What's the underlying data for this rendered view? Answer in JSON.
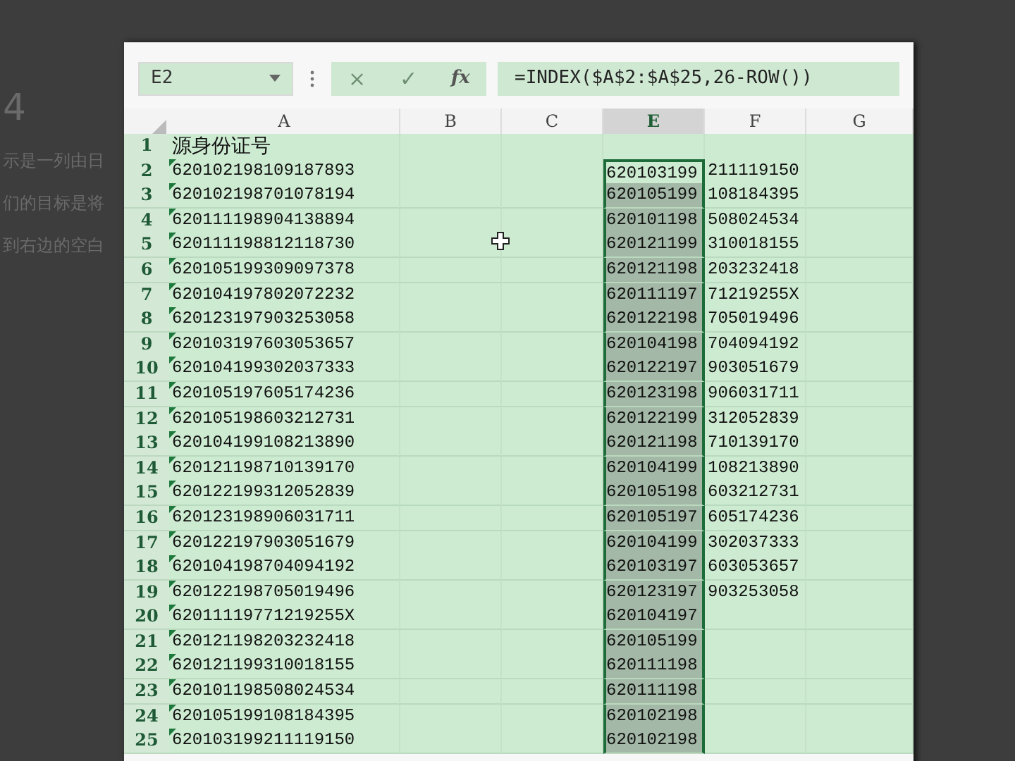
{
  "background": {
    "heading": "4",
    "lines": [
      "示是一列由日",
      "们的目标是将",
      "到右边的空白"
    ]
  },
  "name_box": {
    "value": "E2"
  },
  "formula_bar": {
    "cancel": "×",
    "enter": "✓",
    "fx": "fx",
    "value": "=INDEX($A$2:$A$25,26-ROW())"
  },
  "columns": [
    {
      "label": "A",
      "selected": false
    },
    {
      "label": "B",
      "selected": false
    },
    {
      "label": "C",
      "selected": false
    },
    {
      "label": "E",
      "selected": true
    },
    {
      "label": "F",
      "selected": false
    },
    {
      "label": "G",
      "selected": false
    }
  ],
  "rows": [
    {
      "number": "1",
      "active": false,
      "column_a": "源身份证号"
    },
    {
      "number": "2",
      "active": true,
      "column_a": "620102198109187893",
      "column_e": "620103199",
      "column_f": "211119150"
    },
    {
      "number": "3",
      "active": false,
      "column_a": "620102198701078194",
      "column_e": "620105199",
      "column_f": "108184395"
    },
    {
      "number": "4",
      "active": false,
      "column_a": "620111198904138894",
      "column_e": "620101198",
      "column_f": "508024534"
    },
    {
      "number": "5",
      "active": false,
      "column_a": "620111198812118730",
      "column_e": "620121199",
      "column_f": "310018155"
    },
    {
      "number": "6",
      "active": false,
      "column_a": "620105199309097378",
      "column_e": "620121198",
      "column_f": "203232418"
    },
    {
      "number": "7",
      "active": false,
      "column_a": "620104197802072232",
      "column_e": "620111197",
      "column_f": "71219255X"
    },
    {
      "number": "8",
      "active": false,
      "column_a": "620123197903253058",
      "column_e": "620122198",
      "column_f": "705019496"
    },
    {
      "number": "9",
      "active": false,
      "column_a": "620103197603053657",
      "column_e": "620104198",
      "column_f": "704094192"
    },
    {
      "number": "10",
      "active": false,
      "column_a": "620104199302037333",
      "column_e": "620122197",
      "column_f": "903051679"
    },
    {
      "number": "11",
      "active": false,
      "column_a": "620105197605174236",
      "column_e": "620123198",
      "column_f": "906031711"
    },
    {
      "number": "12",
      "active": false,
      "column_a": "620105198603212731",
      "column_e": "620122199",
      "column_f": "312052839"
    },
    {
      "number": "13",
      "active": false,
      "column_a": "620104199108213890",
      "column_e": "620121198",
      "column_f": "710139170"
    },
    {
      "number": "14",
      "active": false,
      "column_a": "620121198710139170",
      "column_e": "620104199",
      "column_f": "108213890"
    },
    {
      "number": "15",
      "active": false,
      "column_a": "620122199312052839",
      "column_e": "620105198",
      "column_f": "603212731"
    },
    {
      "number": "16",
      "active": false,
      "column_a": "620123198906031711",
      "column_e": "620105197",
      "column_f": "605174236"
    },
    {
      "number": "17",
      "active": false,
      "column_a": "620122197903051679",
      "column_e": "620104199",
      "column_f": "302037333"
    },
    {
      "number": "18",
      "active": false,
      "column_a": "620104198704094192",
      "column_e": "620103197",
      "column_f": "603053657"
    },
    {
      "number": "19",
      "active": false,
      "column_a": "620122198705019496",
      "column_e": "620123197",
      "column_f": "903253058"
    },
    {
      "number": "20",
      "active": false,
      "column_a": "62011119771219255X",
      "column_e": "620104197"
    },
    {
      "number": "21",
      "active": false,
      "column_a": "620121198203232418",
      "column_e": "620105199"
    },
    {
      "number": "22",
      "active": false,
      "column_a": "620121199310018155",
      "column_e": "620111198"
    },
    {
      "number": "23",
      "active": false,
      "column_a": "620101198508024534",
      "column_e": "620111198"
    },
    {
      "number": "24",
      "active": false,
      "column_a": "620105199108184395",
      "column_e": "620102198"
    },
    {
      "number": "25",
      "active": false,
      "column_a": "620103199211119150",
      "column_e": "620102198"
    }
  ]
}
